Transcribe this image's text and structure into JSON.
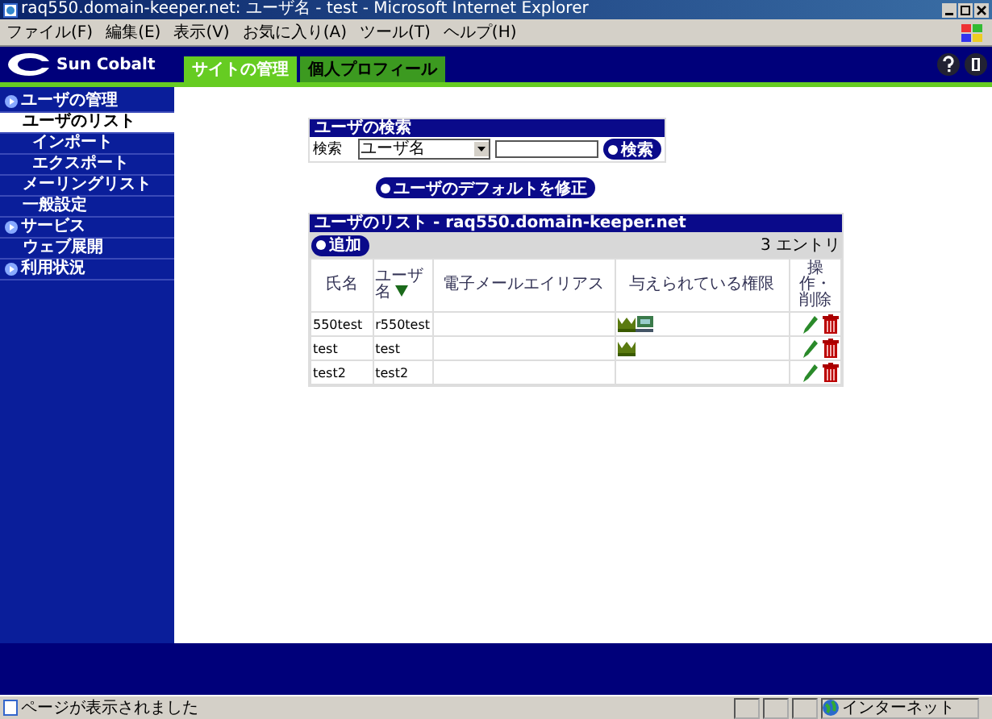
{
  "window": {
    "title": "raq550.domain-keeper.net: ユーザ名 - test - Microsoft Internet Explorer"
  },
  "menu": [
    "ファイル(F)",
    "編集(E)",
    "表示(V)",
    "お気に入り(A)",
    "ツール(T)",
    "ヘルプ(H)"
  ],
  "brand": "Sun Cobalt",
  "tabs": [
    {
      "label": "サイトの管理",
      "selected": true
    },
    {
      "label": "個人プロフィール",
      "selected": false
    }
  ],
  "sidebar": {
    "items": [
      {
        "label": "ユーザの管理",
        "selected": false,
        "children": [
          {
            "label": "ユーザのリスト",
            "selected": true,
            "children": [
              {
                "label": "インポート",
                "selected": false
              },
              {
                "label": "エクスポート",
                "selected": false
              }
            ]
          },
          {
            "label": "メーリングリスト",
            "selected": false
          },
          {
            "label": "一般設定",
            "selected": false
          }
        ]
      },
      {
        "label": "サービス",
        "selected": false,
        "children": [
          {
            "label": "ウェブ展開",
            "selected": false
          }
        ]
      },
      {
        "label": "利用状況",
        "selected": false
      }
    ]
  },
  "search": {
    "title": "ユーザの検索",
    "label": "検索",
    "field": "ユーザ名",
    "button": "検索"
  },
  "defaults_button": "ユーザのデフォルトを修正",
  "list": {
    "title": "ユーザのリスト - raq550.domain-keeper.net",
    "add_button": "追加",
    "count": "3 エントリ",
    "columns": [
      "氏名",
      "ユーザ名",
      "電子メールエイリアス",
      "与えられている権限",
      "操作・削除"
    ],
    "rows": [
      {
        "name": "550test",
        "user": "r550test",
        "rights": [
          {
            "kind": "admin"
          },
          {
            "kind": "shell"
          }
        ]
      },
      {
        "name": "test",
        "user": "test",
        "rights": [
          {
            "kind": "admin"
          }
        ]
      },
      {
        "name": "test2",
        "user": "test2"
      }
    ]
  },
  "status_bar": {
    "message": "ページが表示されました",
    "zone": "インターネット"
  }
}
